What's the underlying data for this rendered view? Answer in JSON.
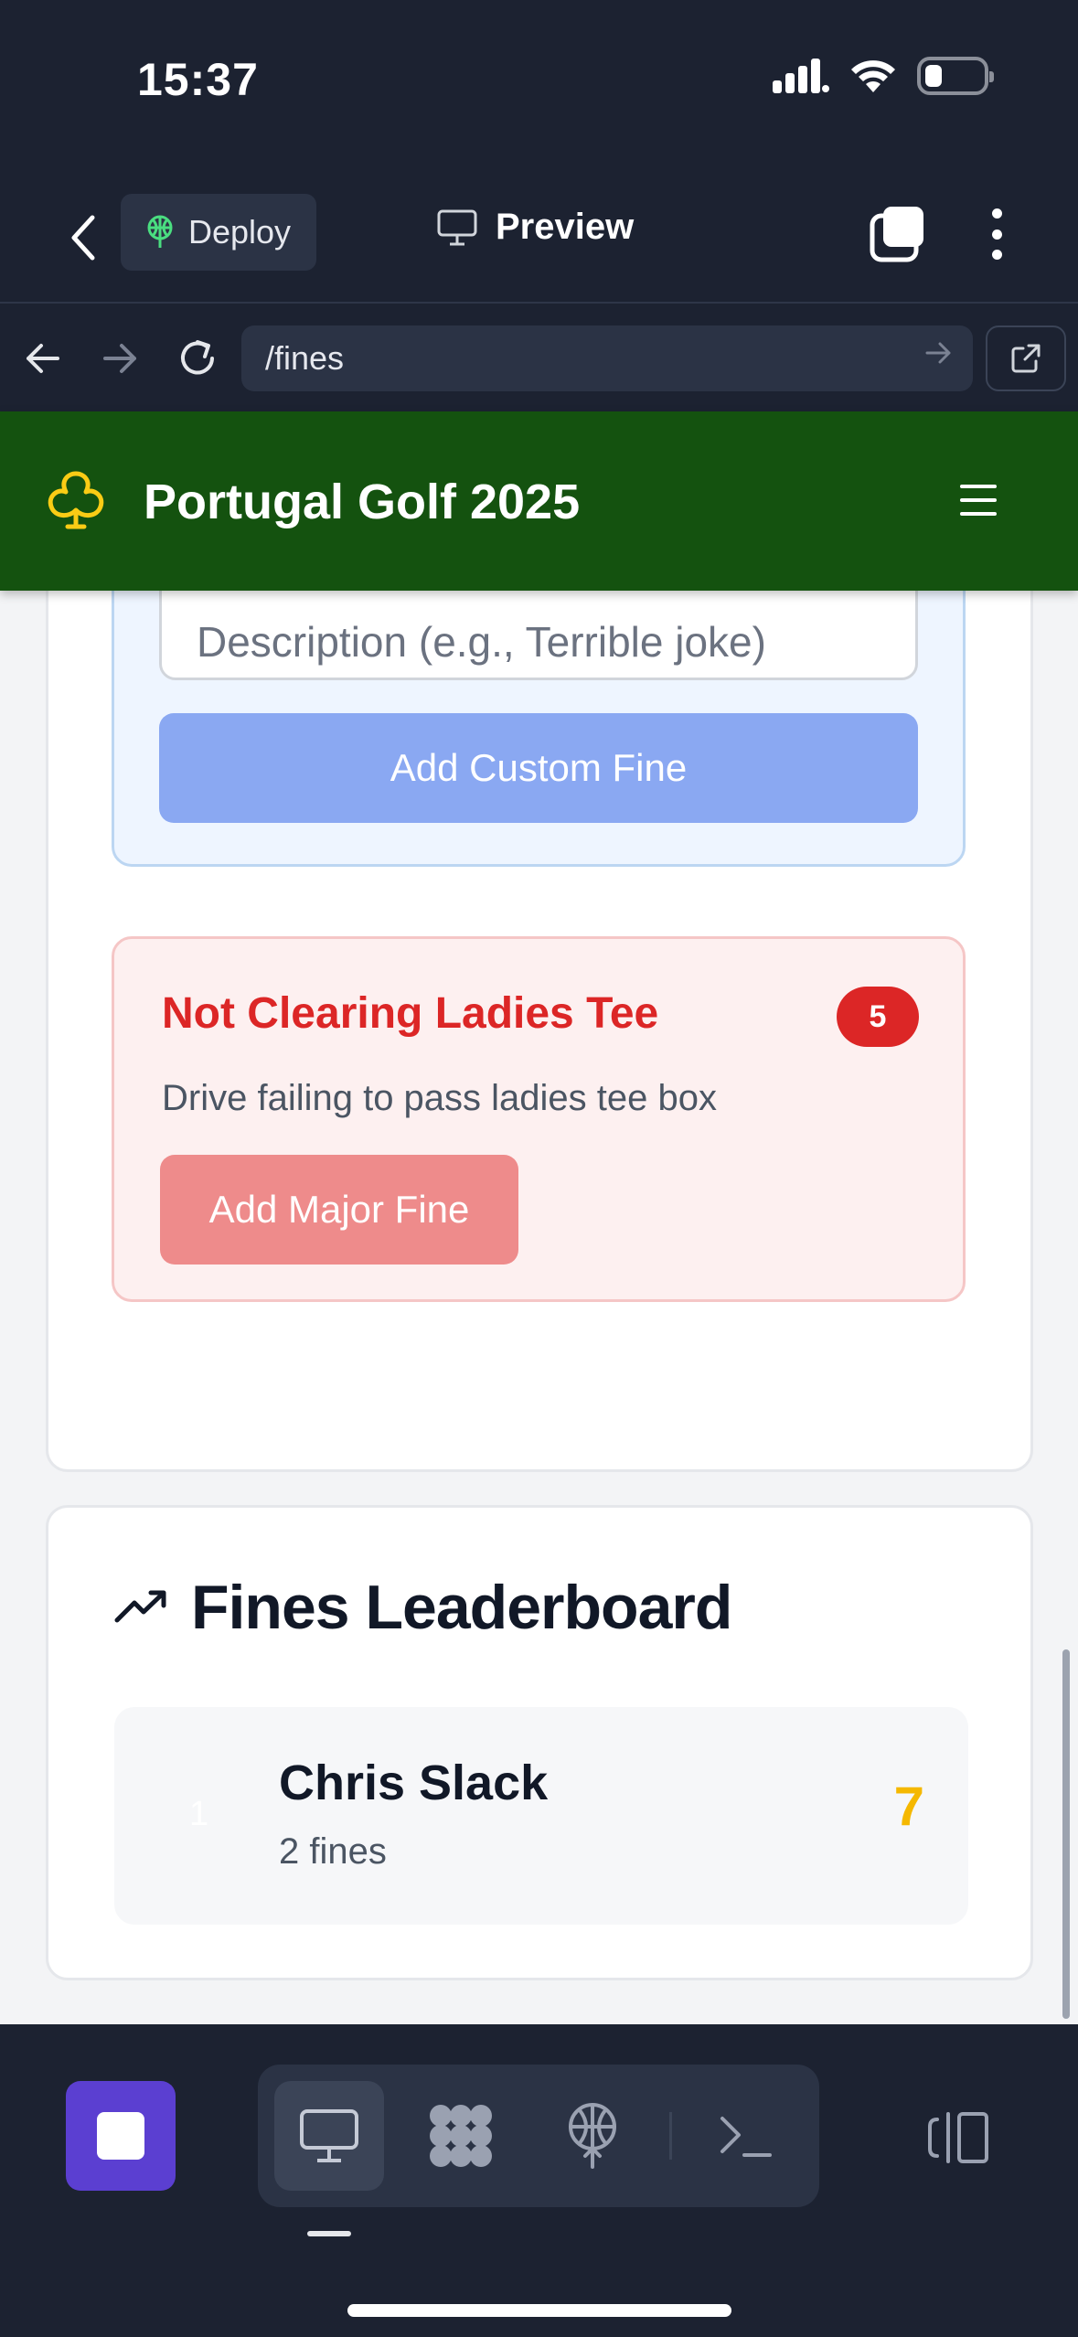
{
  "status_bar": {
    "time": "15:37"
  },
  "top_nav": {
    "deploy_label": "Deploy",
    "preview_label": "Preview"
  },
  "url_bar": {
    "path": "/fines"
  },
  "app": {
    "title": "Portugal Golf 2025"
  },
  "custom_fine": {
    "description_placeholder": "Description (e.g., Terrible joke)",
    "add_button": "Add Custom Fine"
  },
  "major_fine": {
    "title": "Not Clearing Ladies Tee",
    "amount": "5",
    "description": "Drive failing to pass ladies tee box",
    "add_button": "Add Major Fine"
  },
  "leaderboard": {
    "title": "Fines Leaderboard",
    "entries": [
      {
        "rank": "1",
        "name": "Chris Slack",
        "fines": "2 fines",
        "total": "7"
      }
    ]
  },
  "colors": {
    "header_green": "#14520f",
    "accent_red": "#dc2626",
    "total_gold": "#f5b800",
    "stop_purple": "#5b3fd1"
  },
  "icons": {
    "app_logo": "club-icon",
    "leaderboard": "trending-up-icon"
  }
}
